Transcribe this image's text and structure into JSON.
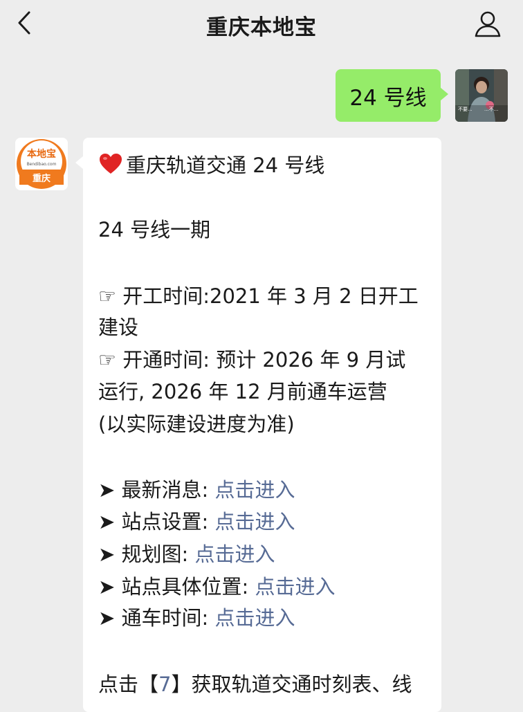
{
  "header": {
    "title": "重庆本地宝"
  },
  "outgoing": {
    "text": "24 号线"
  },
  "bot_avatar": {
    "logo_text": "本地宝",
    "logo_url": "Bendibao.com",
    "city": "重庆"
  },
  "user_avatar": {
    "caption_left": "不要...",
    "caption_right": "...不..."
  },
  "message": {
    "title": "重庆轨道交通 24 号线",
    "phase": "24 号线一期",
    "start_line1": "☞ 开工时间:2021 年 3 月 2 日开工",
    "start_line2": "建设",
    "open_line1": "☞ 开通时间: 预计 2026 年 9 月试",
    "open_line2": "运行, 2026 年 12 月前通车运营",
    "open_line3": "(以实际建设进度为准)",
    "links": [
      {
        "label": "➤ 最新消息: ",
        "action": "点击进入"
      },
      {
        "label": "➤ 站点设置: ",
        "action": "点击进入"
      },
      {
        "label": "➤ 规划图: ",
        "action": "点击进入"
      },
      {
        "label": "➤ 站点具体位置: ",
        "action": "点击进入"
      },
      {
        "label": "➤ 通车时间: ",
        "action": "点击进入"
      }
    ],
    "footer_prefix": "点击【",
    "footer_key": "7",
    "footer_suffix": "】获取轨道交通时刻表、线"
  },
  "colors": {
    "background": "#ededed",
    "outgoing_bubble": "#95ec69",
    "link": "#576b95",
    "brand_orange": "#f07a1e"
  }
}
